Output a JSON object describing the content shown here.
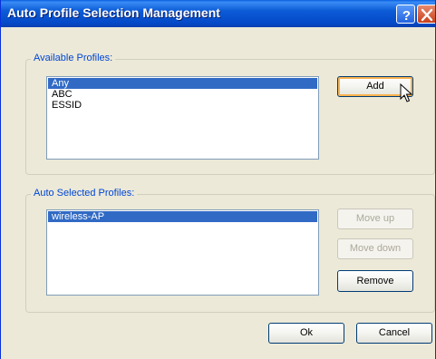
{
  "window": {
    "title": "Auto Profile Selection Management"
  },
  "titlebar": {
    "help_icon": "help-icon",
    "close_icon": "close-icon",
    "help_glyph": "?"
  },
  "available": {
    "legend": "Available Profiles:",
    "items": [
      {
        "label": "Any",
        "selected": true
      },
      {
        "label": "ABC",
        "selected": false
      },
      {
        "label": "ESSID",
        "selected": false
      }
    ],
    "add_label": "Add"
  },
  "auto_selected": {
    "legend": "Auto Selected Profiles:",
    "items": [
      {
        "label": "wireless-AP",
        "selected": true
      }
    ],
    "move_up_label": "Move up",
    "move_down_label": "Move down",
    "remove_label": "Remove"
  },
  "footer": {
    "ok_label": "Ok",
    "cancel_label": "Cancel"
  },
  "colors": {
    "selection": "#316ac5",
    "legend_text": "#0046d5",
    "titlebar": "#0549c8"
  }
}
